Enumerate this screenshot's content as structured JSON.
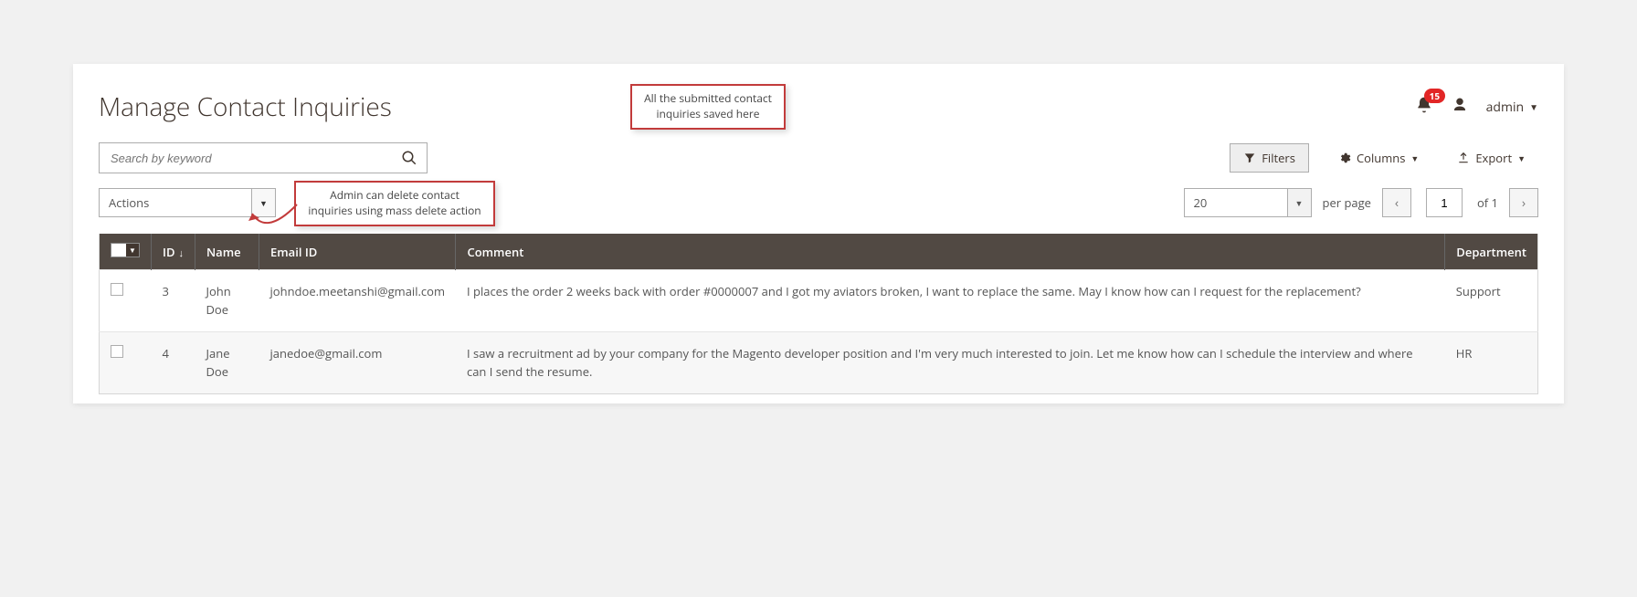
{
  "title": "Manage Contact Inquiries",
  "header": {
    "notification_count": "15",
    "admin_label": "admin"
  },
  "callouts": {
    "top": "All the submitted contact inquiries saved here",
    "actions": "Admin can delete contact inquiries using mass delete action"
  },
  "search": {
    "placeholder": "Search by keyword"
  },
  "controls": {
    "filters": "Filters",
    "columns": "Columns",
    "export": "Export"
  },
  "actions_label": "Actions",
  "pager": {
    "per_page_value": "20",
    "per_page_label": "per page",
    "current": "1",
    "of_label": "of 1"
  },
  "columns": [
    "ID",
    "Name",
    "Email ID",
    "Comment",
    "Department"
  ],
  "rows": [
    {
      "id": "3",
      "name": "John Doe",
      "email": "johndoe.meetanshi@gmail.com",
      "comment": "I places the order 2 weeks back with order #0000007 and I got my aviators broken, I want to replace the same. May I know how can I request for the replacement?",
      "department": "Support"
    },
    {
      "id": "4",
      "name": "Jane Doe",
      "email": "janedoe@gmail.com",
      "comment": "I saw a recruitment ad by your company for the Magento developer position and I'm very much interested to join. Let me know how can I schedule the interview and where can I send the resume.",
      "department": "HR"
    }
  ]
}
